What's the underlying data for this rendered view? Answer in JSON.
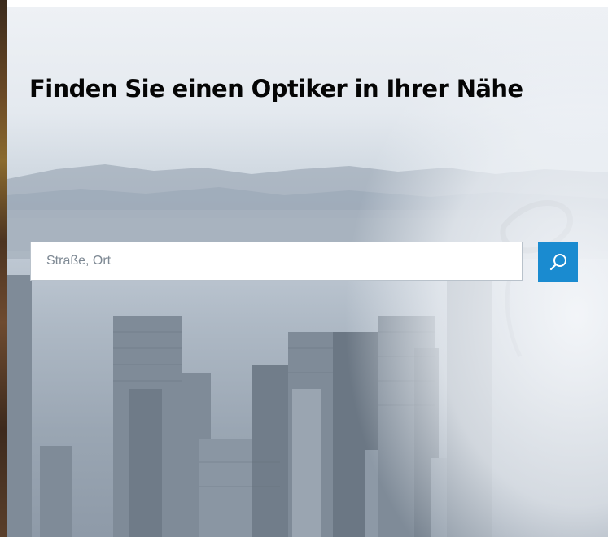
{
  "headline": "Finden Sie einen Optiker in Ihrer Nähe",
  "search": {
    "placeholder": "Straße, Ort",
    "value": ""
  },
  "search_button": {
    "icon": "search-icon"
  },
  "colors": {
    "accent": "#1a8bd0",
    "headline": "#050505",
    "input_border": "#b9c2cb"
  }
}
